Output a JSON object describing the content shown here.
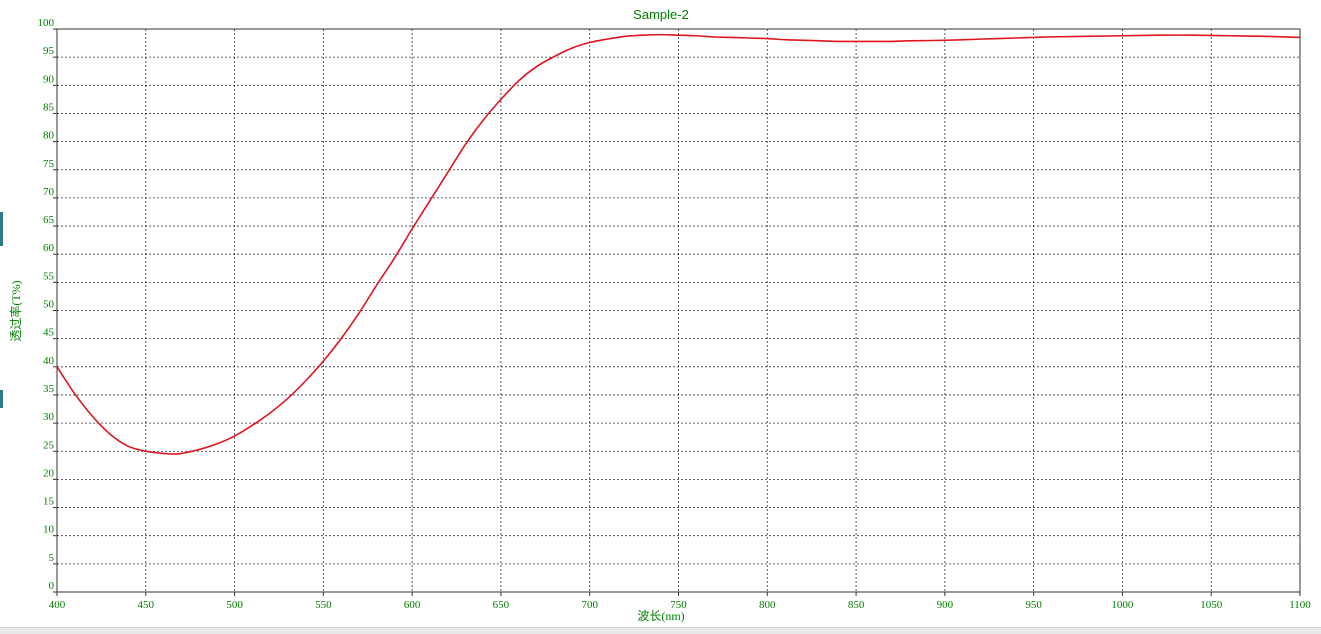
{
  "colors": {
    "text_green": "#008000",
    "series_red": "#e0141e",
    "grid": "#333333",
    "frame": "#333333"
  },
  "chart_data": {
    "type": "line",
    "title": "Sample-2",
    "xlabel": "波长(nm)",
    "ylabel": "透过率(T%)",
    "xlim": [
      400,
      1100
    ],
    "ylim": [
      0,
      100
    ],
    "x_ticks": [
      400,
      450,
      500,
      550,
      600,
      650,
      700,
      750,
      800,
      850,
      900,
      950,
      1000,
      1050,
      1100
    ],
    "y_ticks": [
      0,
      5,
      10,
      15,
      20,
      25,
      30,
      35,
      40,
      45,
      50,
      55,
      60,
      65,
      70,
      75,
      80,
      85,
      90,
      95,
      100
    ],
    "grid": true,
    "grid_style": "dotted",
    "legend": "none",
    "series": [
      {
        "x": [
          400,
          410,
          420,
          430,
          440,
          450,
          460,
          465,
          470,
          480,
          490,
          500,
          510,
          520,
          530,
          540,
          550,
          560,
          570,
          580,
          590,
          600,
          610,
          620,
          630,
          640,
          650,
          660,
          670,
          680,
          690,
          700,
          710,
          720,
          730,
          740,
          750,
          760,
          770,
          780,
          790,
          800,
          810,
          820,
          830,
          840,
          850,
          860,
          870,
          880,
          900,
          920,
          940,
          960,
          980,
          1000,
          1020,
          1040,
          1060,
          1080,
          1100
        ],
        "y": [
          40.0,
          35.2,
          31.2,
          28.0,
          25.9,
          25.0,
          24.6,
          24.5,
          24.6,
          25.3,
          26.3,
          27.7,
          29.6,
          31.8,
          34.4,
          37.5,
          41.0,
          45.0,
          49.5,
          54.5,
          59.3,
          64.5,
          69.5,
          74.5,
          79.5,
          83.8,
          87.5,
          90.8,
          93.3,
          95.1,
          96.6,
          97.6,
          98.2,
          98.7,
          98.9,
          99.0,
          98.9,
          98.8,
          98.6,
          98.5,
          98.4,
          98.3,
          98.1,
          98.0,
          97.9,
          97.8,
          97.8,
          97.8,
          97.8,
          97.9,
          98.0,
          98.2,
          98.4,
          98.6,
          98.7,
          98.8,
          98.9,
          98.9,
          98.8,
          98.7,
          98.5
        ]
      }
    ]
  }
}
